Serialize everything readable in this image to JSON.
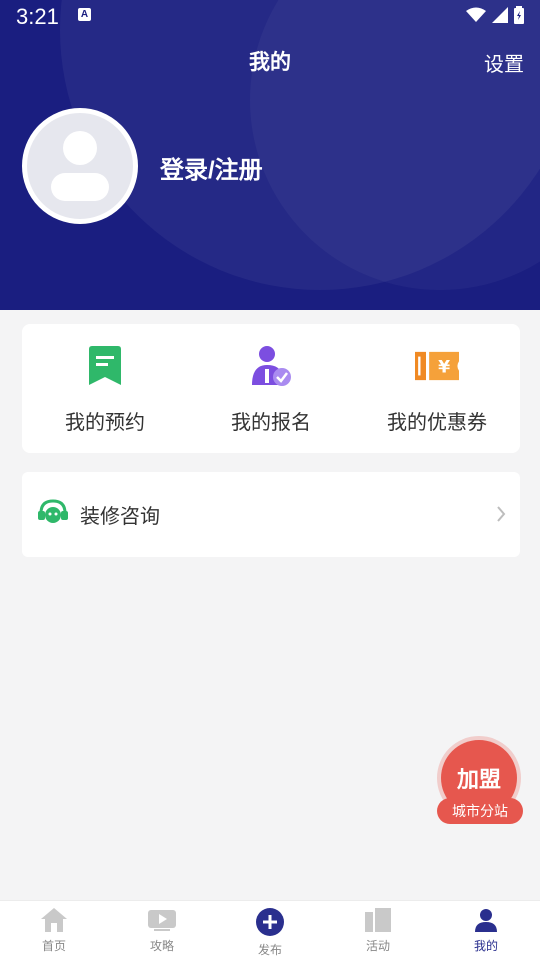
{
  "status_bar": {
    "time": "3:21",
    "a_icon": "A"
  },
  "header": {
    "title": "我的",
    "settings_label": "设置",
    "login_label": "登录/注册"
  },
  "quick_actions": [
    {
      "label": "我的预约",
      "icon": "bookmark-icon",
      "color": "#2fb86a"
    },
    {
      "label": "我的报名",
      "icon": "user-check-icon",
      "color": "#7c4ee0"
    },
    {
      "label": "我的优惠券",
      "icon": "coupon-icon",
      "color": "#f08a24"
    }
  ],
  "consult": {
    "label": "装修咨询",
    "icon": "headset-icon"
  },
  "join_badge": {
    "title": "加盟",
    "subtitle": "城市分站"
  },
  "tabs": [
    {
      "label": "首页",
      "icon": "home-icon"
    },
    {
      "label": "攻略",
      "icon": "video-icon"
    },
    {
      "label": "发布",
      "icon": "plus-circle-icon"
    },
    {
      "label": "活动",
      "icon": "activity-icon"
    },
    {
      "label": "我的",
      "icon": "profile-icon",
      "active": true
    }
  ],
  "colors": {
    "header_bg": "#1a1e80",
    "accent": "#2a2f8e",
    "badge": "#e6574e"
  }
}
